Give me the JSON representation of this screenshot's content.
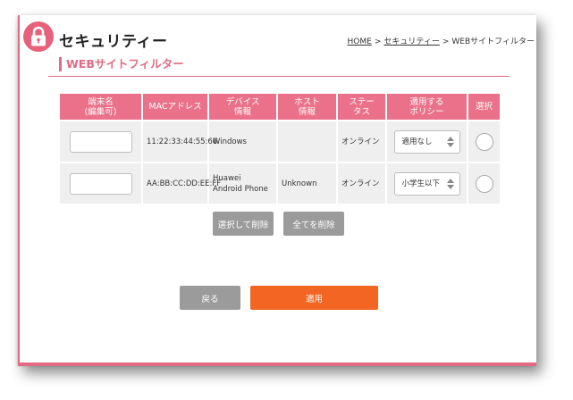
{
  "header": {
    "title": "セキュリティー",
    "breadcrumb": {
      "home": "HOME",
      "sep1": ">",
      "security": "セキュリティー",
      "sep2": ">",
      "current": "WEBサイトフィルター"
    }
  },
  "section": {
    "title": "WEBサイトフィルター"
  },
  "table": {
    "columns": [
      "端末名\n(編集可)",
      "MACアドレス",
      "デバイス\n情報",
      "ホスト\n情報",
      "ステー\nタス",
      "適用する\nポリシー",
      "選択"
    ],
    "rows": [
      {
        "name": "",
        "mac": "11:22:33:44:55:66",
        "device": "Windows",
        "host": "",
        "status": "オンライン",
        "policy": "適用なし"
      },
      {
        "name": "",
        "mac": "AA:BB:CC:DD:EE:FF",
        "device": "Huawei Android Phone",
        "host": "Unknown",
        "status": "オンライン",
        "policy": "小学生以下"
      }
    ]
  },
  "actions": {
    "delete_selected": "選択して削除",
    "delete_all": "全てを削除",
    "back": "戻る",
    "apply": "適用"
  },
  "colors": {
    "accent": "#e8617a",
    "header_bg": "#ea7189",
    "apply": "#f26522",
    "gray_button": "#9b9b9b"
  },
  "icons": {
    "title_icon": "lock-icon"
  }
}
